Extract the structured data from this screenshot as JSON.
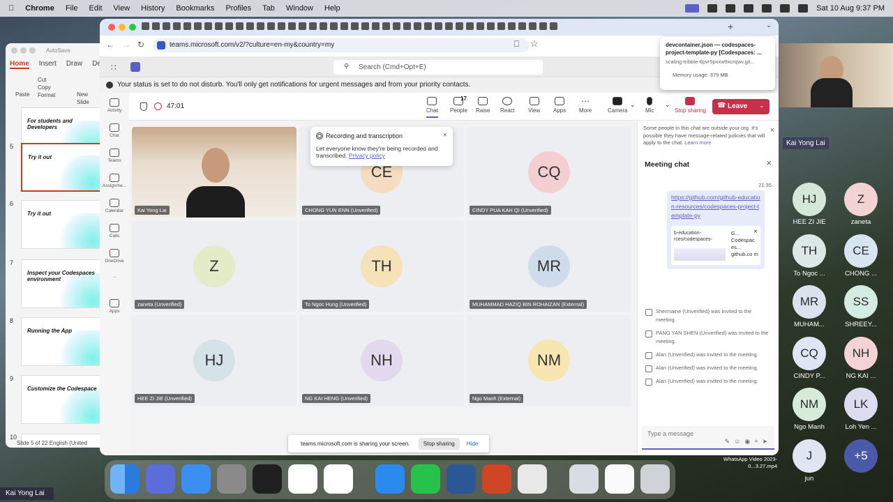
{
  "menubar": {
    "apple": "",
    "app": "Chrome",
    "items": [
      "File",
      "Edit",
      "View",
      "History",
      "Bookmarks",
      "Profiles",
      "Tab",
      "Window",
      "Help"
    ],
    "datetime": "Sat 10 Aug  9:37 PM"
  },
  "ppt": {
    "autosave": "AutoSave",
    "tabs": [
      "Home",
      "Insert",
      "Draw",
      "De"
    ],
    "ribbon": [
      "Cut",
      "Copy",
      "Format",
      "Paste",
      "New Slide"
    ],
    "slides": [
      {
        "num": "",
        "title": "For students and Developers"
      },
      {
        "num": "5",
        "title": "Try it out"
      },
      {
        "num": "6",
        "title": "Try it out"
      },
      {
        "num": "7",
        "title": "Inspect your Codespaces environment"
      },
      {
        "num": "8",
        "title": "Running the App"
      },
      {
        "num": "9",
        "title": "Customize the Codespace"
      },
      {
        "num": "10",
        "title": ""
      }
    ],
    "status": "Slide 5 of 22   English (United"
  },
  "browser": {
    "url": "teams.microsoft.com/v2/?culture=en-my&country=my"
  },
  "popup": {
    "title": "devcontainer.json — codespaces-project-template-py [Codespaces: ...",
    "sub": "scaling-tribble-6pvr5pxxw9xcrqwv.git...",
    "memory": "Memory usage: 379 MB"
  },
  "teams": {
    "search": "Search (Cmd+Opt+E)",
    "notice": "Your status is set to do not disturb. You'll only get notifications for urgent messages and from your priority contacts.",
    "sidebar": [
      "Activity",
      "Chat",
      "Teams",
      "Assignme...",
      "Calendar",
      "Calls",
      "OneDrive",
      "...",
      "Apps"
    ],
    "timer": "47:01",
    "toolbar": {
      "chat": "Chat",
      "people": "People",
      "people_count": "17",
      "raise": "Raise",
      "react": "React",
      "view": "View",
      "apps": "Apps",
      "more": "More",
      "camera": "Camera",
      "mic": "Mic",
      "stop": "Stop sharing",
      "leave": "Leave"
    },
    "recording": {
      "title": "Recording and transcription",
      "body": "Let everyone know they're being recorded and transcribed.",
      "link": "Privacy policy"
    },
    "tiles": [
      {
        "initials": "",
        "name": "Kai Yong Lai",
        "video": true
      },
      {
        "initials": "CE",
        "name": "CHONG YUN ENN (Unverified)",
        "color": "#f6dcc0"
      },
      {
        "initials": "CQ",
        "name": "CINDY PUA KAH QI (Unverified)",
        "color": "#f4cfd2"
      },
      {
        "initials": "Z",
        "name": "zaneta (Unverified)",
        "color": "#e3ebc8"
      },
      {
        "initials": "TH",
        "name": "To Ngoc Hung (Unverified)",
        "color": "#f6e2b8"
      },
      {
        "initials": "MR",
        "name": "MUHAMMAD HAZIQ BIN ROHAIZAN (External)",
        "color": "#cfdceb"
      },
      {
        "initials": "HJ",
        "name": "HEE ZI JIE (Unverified)",
        "color": "#d5e3e8"
      },
      {
        "initials": "NH",
        "name": "NG KAI HENG (Unverified)",
        "color": "#e2d9ee"
      },
      {
        "initials": "NM",
        "name": "Ngo Manh (External)",
        "color": "#f7e6b2"
      }
    ],
    "chat": {
      "external": "Some people in this chat are outside your org. It's possible they have message-related policies that will apply to the chat.",
      "learn": "Learn more",
      "title": "Meeting chat",
      "time": "21:35",
      "link": "https://github.com/github-education-resources/codespaces-project-template-py",
      "card_l": "b-education- rces/codespaces-",
      "card_r": "G... Codespac es... github.co m",
      "system": [
        "Shermaine (Unverified) was invited to the meeting.",
        "PANG YAN SHEN (Unverified) was invited to the meeting.",
        "Alan (Unverified) was invited to the meeting.",
        "Alan (Unverified) was invited to the meeting.",
        "Alan (Unverified) was invited to the meeting."
      ],
      "placeholder": "Type a message"
    },
    "share": {
      "text": "teams.microsoft.com is sharing your screen.",
      "stop": "Stop sharing",
      "hide": "Hide"
    }
  },
  "participants": {
    "self": "Kai Yong Lai",
    "list": [
      {
        "i": "HJ",
        "n": "HEE ZI JIE",
        "c": "#d5e8d8"
      },
      {
        "i": "Z",
        "n": "zaneta",
        "c": "#f3d2d3"
      },
      {
        "i": "TH",
        "n": "To Ngoc ...",
        "c": "#dbe8e6"
      },
      {
        "i": "CE",
        "n": "CHONG ...",
        "c": "#d8e4f0"
      },
      {
        "i": "MR",
        "n": "MUHAM...",
        "c": "#dbe2ee"
      },
      {
        "i": "SS",
        "n": "SHREEY...",
        "c": "#d4ece1"
      },
      {
        "i": "CQ",
        "n": "CINDY P...",
        "c": "#dde6f3"
      },
      {
        "i": "NH",
        "n": "NG KAI ...",
        "c": "#f3d3d5"
      },
      {
        "i": "NM",
        "n": "Ngo Manh",
        "c": "#d6ecd9"
      },
      {
        "i": "LK",
        "n": "Loh Yen ...",
        "c": "#dcdcf0"
      },
      {
        "i": "J",
        "n": "jun",
        "c": "#dfe6f2"
      },
      {
        "i": "+5",
        "n": "",
        "c": "#4a5aa8"
      }
    ]
  },
  "desktop": {
    "file": "WhatsApp Video 2023-0...3.27.mp4",
    "tag": "Kai Yong Lai"
  }
}
